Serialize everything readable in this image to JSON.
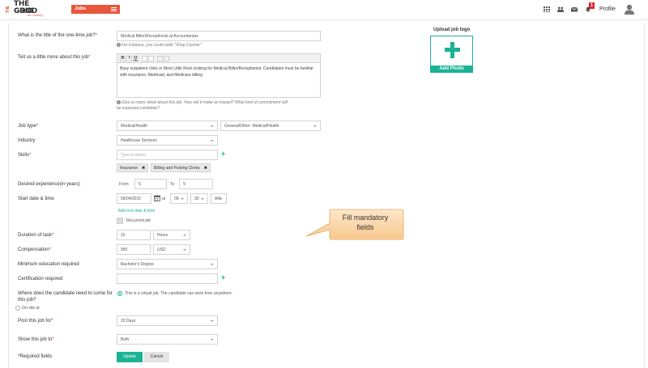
{
  "header": {
    "logo_line1": "THE GOOD",
    "logo_line2": "GRID",
    "logo_tagline": "for Healthy",
    "logo_side": "THE",
    "jobs_menu": "Jobs",
    "notifications_count": "1",
    "profile_label": "Profile"
  },
  "form": {
    "title_label": "What is the title of the one-time job?",
    "title_value": "Medical Biller/Receptionist at Accountemps",
    "title_hint": "For instance, you could write \"Shop Cashier\"",
    "desc_label": "Tell us a little more about this job",
    "desc_value": "Busy outpatient clinic in West Little Rock looking for Medical Biller/Receptionist. Candidates must be familiar with insurance, Medicaid, and Medicare billing",
    "desc_hint_line1": "Give us more detail about this job. How will it make an impact? What kind of commitment will",
    "desc_hint_line2": "be expected candidate?",
    "job_type_label": "Job type",
    "job_type_value": "Medical/Health",
    "job_subtype_value": "General/Other: Medical/Health",
    "industry_label": "Industry",
    "industry_value": "Healthcare Services",
    "skills_label": "Skills",
    "skills_placeholder": "Type to select",
    "skills": [
      "Insurance",
      "Billing and Posting Clerks"
    ],
    "experience_label": "Desired experience(in years)",
    "exp_from_label": "From",
    "exp_from_value": "5",
    "exp_to_label": "To",
    "exp_to_value": "9",
    "start_label": "Start date & time",
    "start_date": "06/04/2015",
    "at_label": "at",
    "start_hour": "09",
    "start_min": "30",
    "start_ampm": "AM",
    "add_date_link": "Add end date & time",
    "recurrent_label": "Recurrent job",
    "duration_label": "Duration of task",
    "duration_value": "15",
    "duration_unit": "Hours",
    "comp_label": "Compensation",
    "comp_value": "950",
    "comp_currency": "USD",
    "education_label": "Minimum education required",
    "education_value": "Bachelor's Degree",
    "cert_label": "Certification required",
    "cert_value": "",
    "location_label_line1": "Where does the candidate need to come for",
    "location_label_line2": "this job?",
    "virtual_text": "This is a virtual job. The candidate can work from anywhere.",
    "onsite_label": "On-site at",
    "post_label": "Post this job for",
    "post_value": "20 Days",
    "show_label": "Show this job to",
    "show_value": "Both",
    "required_note": "*Required fields",
    "update_btn": "Update",
    "cancel_btn": "Cancel",
    "required_star": "*"
  },
  "upload": {
    "title": "Upload job logo",
    "button": "Add Photo"
  },
  "callout": {
    "line1": "Fill mandatory",
    "line2": "fields"
  },
  "editor": {
    "bold": "B",
    "italic": "I",
    "underline": "U"
  }
}
